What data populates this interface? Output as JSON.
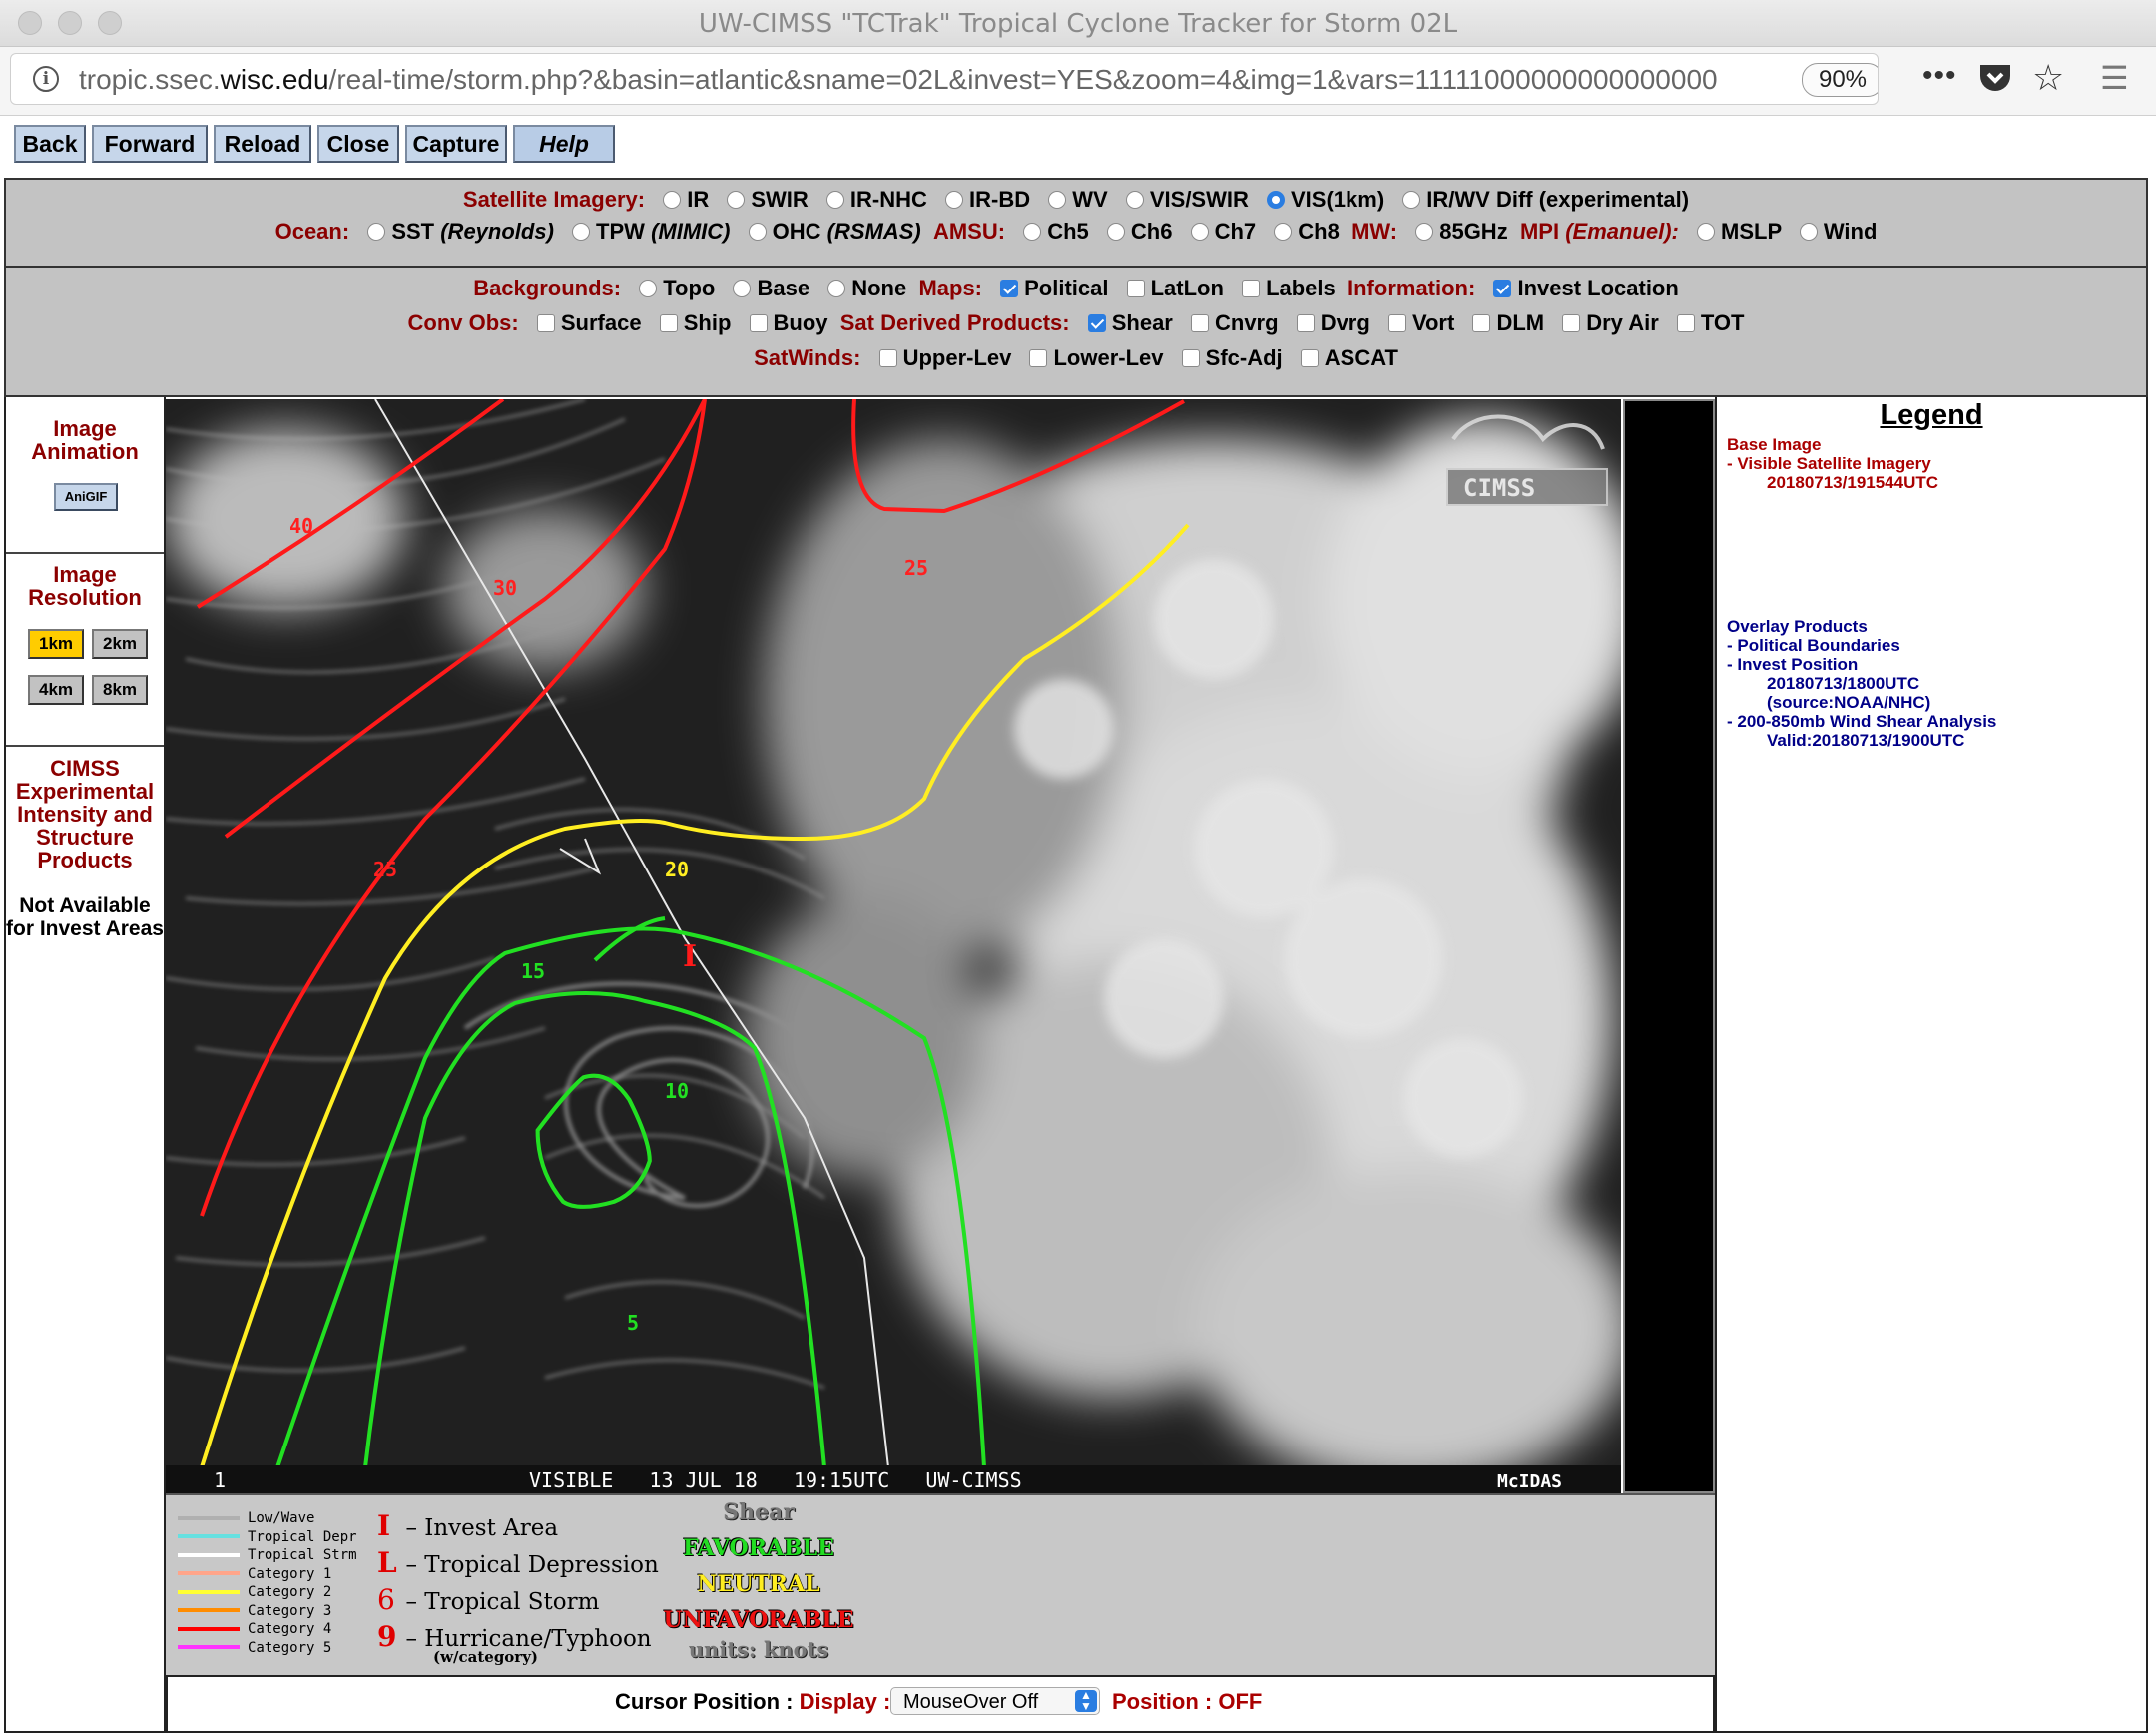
{
  "window": {
    "title": "UW-CIMSS \"TCTrak\" Tropical Cyclone Tracker for Storm 02L"
  },
  "browser": {
    "url_prefix": "tropic.ssec.",
    "url_domain": "wisc.edu",
    "url_rest": "/real-time/storm.php?&basin=atlantic&sname=02L&invest=YES&zoom=4&img=1&vars=11111000000000000000",
    "zoom": "90%",
    "icons": [
      "info-icon",
      "more-icon",
      "pocket-icon",
      "bookmark-star-icon",
      "hamburger-menu-icon"
    ]
  },
  "toolbar": {
    "back": "Back",
    "forward": "Forward",
    "reload": "Reload",
    "close": "Close",
    "capture": "Capture",
    "help": "Help"
  },
  "controls": {
    "row1": {
      "label": "Satellite Imagery:",
      "options": [
        {
          "label": "IR",
          "checked": false
        },
        {
          "label": "SWIR",
          "checked": false
        },
        {
          "label": "IR-NHC",
          "checked": false
        },
        {
          "label": "IR-BD",
          "checked": false
        },
        {
          "label": "WV",
          "checked": false
        },
        {
          "label": "VIS/SWIR",
          "checked": false
        },
        {
          "label": "VIS(1km)",
          "checked": true
        },
        {
          "label": "IR/WV Diff (experimental)",
          "checked": false
        }
      ]
    },
    "row2": {
      "ocean_label": "Ocean:",
      "sst": "SST",
      "sst_src": "(Reynolds)",
      "tpw": "TPW",
      "tpw_src": "(MIMIC)",
      "ohc": "OHC",
      "ohc_src": "(RSMAS)",
      "amsu_label": "AMSU:",
      "ch5": "Ch5",
      "ch6": "Ch6",
      "ch7": "Ch7",
      "ch8": "Ch8",
      "mw_label": "MW:",
      "ghz": "85GHz",
      "mpi_label": "MPI",
      "mpi_src": "(Emanuel):",
      "mslp": "MSLP",
      "wind": "Wind"
    },
    "row3": {
      "backgrounds_label": "Backgrounds:",
      "topo": "Topo",
      "base": "Base",
      "none": "None",
      "maps_label": "Maps:",
      "political": "Political",
      "latlon": "LatLon",
      "labels": "Labels",
      "information_label": "Information:",
      "invest_location": "Invest Location"
    },
    "row4": {
      "convobs_label": "Conv Obs:",
      "surface": "Surface",
      "ship": "Ship",
      "buoy": "Buoy",
      "satderived_label": "Sat Derived Products:",
      "shear": "Shear",
      "cnvrg": "Cnvrg",
      "dvrg": "Dvrg",
      "vort": "Vort",
      "dlm": "DLM",
      "dryair": "Dry Air",
      "tot": "TOT"
    },
    "row5": {
      "satwinds_label": "SatWinds:",
      "upper": "Upper-Lev",
      "lower": "Lower-Lev",
      "sfcadj": "Sfc-Adj",
      "ascat": "ASCAT"
    }
  },
  "left": {
    "animation_title": "Image Animation",
    "anigif": "AniGIF",
    "resolution_title": "Image Resolution",
    "res_1km": "1km",
    "res_2km": "2km",
    "res_4km": "4km",
    "res_8km": "8km",
    "cimss_title": "CIMSS Experimental Intensity and Structure Products",
    "not_available": "Not Available for Invest Areas"
  },
  "image": {
    "frame": "1",
    "bar_text": "VISIBLE   13 JUL 18   19:15UTC   UW-CIMSS",
    "mcidas": "McIDAS",
    "logo": "CIMSS",
    "contours": [
      "40",
      "30",
      "25",
      "25",
      "20",
      "15",
      "10",
      "5"
    ],
    "invest_marker": "I"
  },
  "key": {
    "tracks": [
      "Low/Wave",
      "Tropical Depr",
      "Tropical Strm",
      "Category 1",
      "Category 2",
      "Category 3",
      "Category 4",
      "Category 5"
    ],
    "track_colors": [
      "#b0b0b0",
      "#66e0e0",
      "#ffffff",
      "#ffa58a",
      "#ffff33",
      "#ff8c00",
      "#ff0000",
      "#ff33ff"
    ],
    "symbols": [
      "– Invest Area",
      "– Tropical Depression",
      "– Tropical Storm",
      "– Hurricane/Typhoon"
    ],
    "symbol_chars": [
      "I",
      "L",
      "6",
      "9"
    ],
    "w_category": "(w/category)",
    "shear_title": "Shear",
    "favorable": "FAVORABLE",
    "neutral": "NEUTRAL",
    "unfavorable": "UNFAVORABLE",
    "units": "units: knots"
  },
  "cursor": {
    "label": "Cursor Position :",
    "display_label": "Display :",
    "select_value": "MouseOver Off",
    "position_label": "Position :",
    "position_value": "OFF"
  },
  "legend": {
    "title": "Legend",
    "base_image": "Base Image",
    "base_item": "-  Visible Satellite Imagery",
    "base_time": "20180713/191544UTC",
    "overlay_title": "Overlay Products",
    "overlay_1": "-  Political Boundaries",
    "overlay_2": "-  Invest Position",
    "overlay_2_time": "20180713/1800UTC",
    "overlay_2_src": "(source:NOAA/NHC)",
    "overlay_3": "-  200-850mb Wind Shear Analysis",
    "overlay_3_valid": "Valid:20180713/1900UTC"
  }
}
